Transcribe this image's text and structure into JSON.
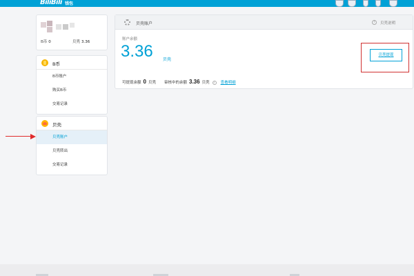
{
  "header": {
    "logo_text": "BiliBili",
    "logo_sub": "钱包"
  },
  "user": {
    "b_coin_label": "B币",
    "b_coin_value": "0",
    "shell_label": "贝壳",
    "shell_value": "3.36"
  },
  "sidebar": {
    "coin_menu": {
      "title": "B币",
      "items": [
        "B币账户",
        "购买B币",
        "交易记录"
      ]
    },
    "shell_menu": {
      "title": "贝壳",
      "items": [
        "贝壳账户",
        "贝壳转出",
        "交易记录"
      ],
      "active_index": 0
    }
  },
  "main": {
    "title": "贝壳账户",
    "help_label": "贝壳说明",
    "help_icon": "?",
    "balance_label": "账户余额",
    "balance_value": "3.36",
    "balance_unit": "贝壳",
    "withdraw_button": "贝壳提现",
    "withdrawable_label": "可提现余额",
    "withdrawable_value": "0",
    "withdrawable_unit": "贝壳",
    "reviewing_label": "审核中的余额",
    "reviewing_value": "3.36",
    "reviewing_unit": "贝壳",
    "reviewing_icon": "i",
    "detail_link": "查看明细"
  },
  "colors": {
    "brand_blue": "#00a1d6",
    "annotation_red": "#e02b2b"
  },
  "icons": {
    "settings": "gear-icon",
    "help": "question-icon",
    "coin": "b-coin-icon",
    "shell": "shell-icon"
  }
}
